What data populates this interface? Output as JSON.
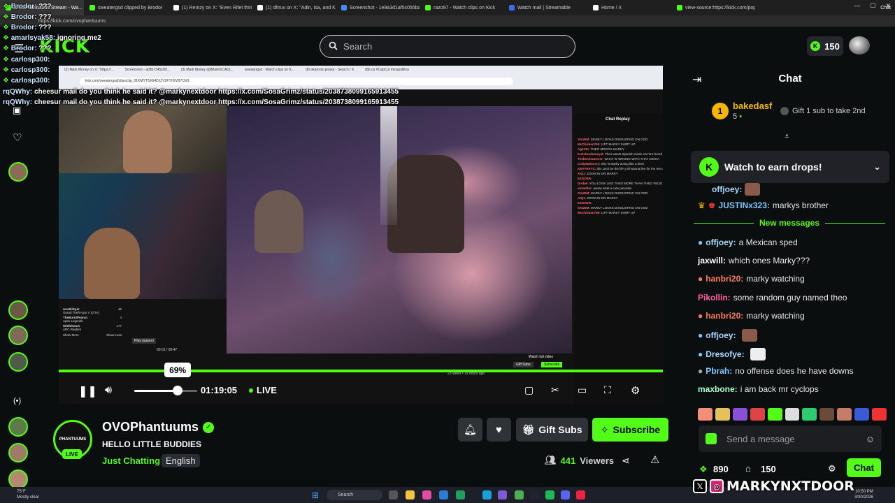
{
  "browser": {
    "tabs": [
      {
        "label": "OVOPhantuums Stream - Wa...",
        "active": true
      },
      {
        "label": "sweatergsd clipped by Brodor"
      },
      {
        "label": "(1) Remzy on X: \"Even Rifet thinks\""
      },
      {
        "label": "(1) dhruv on X: \"Adin, isa, and Kai\""
      },
      {
        "label": "Screenshot - 1e9a3d1af5c055ba7..."
      },
      {
        "label": "razo97 - Watch clips on Kick"
      },
      {
        "label": "Watch mail | Streamable"
      },
      {
        "label": "Home / X"
      },
      {
        "label": "view-source:https://kick.com/pop..."
      }
    ],
    "url": "https://kick.com/ovophantuums",
    "chat_button": "Chat"
  },
  "header": {
    "logo": "KICK",
    "search_placeholder": "Search",
    "coins": "150"
  },
  "overlay_chat": [
    {
      "user": "Brodor:",
      "text": "???"
    },
    {
      "user": "Brodor:",
      "text": "???"
    },
    {
      "user": "Brodor:",
      "text": "???"
    },
    {
      "user": "amarlsyak58:",
      "text": "ignoring me2"
    },
    {
      "user": "Brodor:",
      "text": "???"
    },
    {
      "user": "carlosp300:",
      "text": ""
    },
    {
      "user": "carlosp300:",
      "text": ""
    },
    {
      "user": "carlosp300:",
      "text": ""
    },
    {
      "user": "rqQWhy:",
      "text": "cheesur mail do you think he said it? @markynextdoor https://x.com/SosaGrimz/status/2038738099165913455"
    },
    {
      "user": "rqQWhy:",
      "text": "cheesur mail do you think he said it? @markynextdoor https://x.com/SosaGrimz/status/2038738099165913455"
    }
  ],
  "video": {
    "inner_tabs": [
      "(2) Mark Money on X: \"https://...",
      "Screenshot - a08b7345189...",
      "(3) Mark Money (@MarkInCAD)...",
      "sweatergsd - Watch clips on K...",
      "(8) okamoto jersey - Search / X",
      "(8)Los #CapCut #sospollitos"
    ],
    "inner_url": "kick.com/sweatergsd/clips/clip_01KMYT59G4DJZV2FTH2VB7CM1",
    "inner_chat_title": "Chat Replay",
    "inner_chat_lines": [
      {
        "user": "SAUEM:",
        "text": "MARKY LOOKS DISGUSTING ON GOD"
      },
      {
        "user": "McChicken769:",
        "text": "LIFT MARKY SHIRT UP"
      },
      {
        "user": "Ag213x:",
        "text": "THEO MOGGS MARKY"
      },
      {
        "user": "brandondumeyal:",
        "text": "Theo wants Spanish music on he's bored"
      },
      {
        "user": "Thebestnamever:",
        "text": "WHAT IS WRONG WITH THAT NIGGA"
      },
      {
        "user": "CodyMahoney:",
        "text": "why is Marky acting like a bitch"
      },
      {
        "user": "KEVYNVYC:",
        "text": "this can't be the life y'all wanna live for the rest of y'all life"
      },
      {
        "user": "AIQ1:",
        "text": "ZOOM IN ON MARKY"
      },
      {
        "user": "EZGOER:",
        "text": ""
      },
      {
        "user": "Dorbel:",
        "text": "YOU LOOK LIKE THEO MORE THAN THEO VIEJO"
      },
      {
        "user": "vintwilter:",
        "text": "awww what a cute pasoolie"
      },
      {
        "user": "SAUEM:",
        "text": "MARKY LOOKS DISGUSTING ON GOD"
      },
      {
        "user": "AIQ1:",
        "text": "ZOOM IN ON MARKY"
      },
      {
        "user": "EZGOER:",
        "text": ""
      },
      {
        "user": "SAUEM:",
        "text": "MARKY LOOKS DISGUSTING ON GOD"
      },
      {
        "user": "McChicken769:",
        "text": "LIFT MARKY SHIRT UP"
      }
    ],
    "inner_views": "23 views • 19 hours ago",
    "inner_buttons": [
      "Gift Subs",
      "Subscribe",
      "Watch full video"
    ],
    "inner_stream_list": [
      {
        "name": "westkitty4r",
        "game": "Grand Theft Auto V (GTA)",
        "count": "45"
      },
      {
        "name": "TheBurntPeanut",
        "game": "Apex Legends",
        "count": "4"
      },
      {
        "name": "Wittlebears",
        "game": "ARC Raiders",
        "count": "177"
      }
    ],
    "inner_show": [
      "Show More",
      "Show Less"
    ],
    "inner_time": "00:01 / 00:47",
    "inner_tooltip": "Play (space)"
  },
  "player": {
    "volume_percent": 69,
    "volume_tooltip": "69%",
    "time": "01:19:05",
    "live_label": "LIVE"
  },
  "stream": {
    "channel_name": "OVOPhantuums",
    "avatar_text": "PHANTUUMS",
    "live_badge": "LIVE",
    "title": "HELLO LITTLE BUDDIES",
    "category": "Just Chatting",
    "language": "English",
    "gift_subs": "Gift Subs",
    "subscribe": "Subscribe",
    "viewers_count": "441",
    "viewers_label": "Viewers"
  },
  "chat": {
    "title": "Chat",
    "pinned_user": "bakedasf",
    "pinned_rank": "1",
    "pinned_count": "5",
    "gift_prompt": "Gift 1 sub to take 2nd",
    "drops_banner": "Watch to earn drops!",
    "partial_user": "offjoey:",
    "messages_before": [
      {
        "user": "JUSTINx323:",
        "text": "markys brother",
        "color": "#53fc18"
      }
    ],
    "new_messages_label": "New messages",
    "messages": [
      {
        "user": "offjoey:",
        "text": "a Mexican sped",
        "color": "#a8d8ff"
      },
      {
        "user": "jaxwill:",
        "text": "which ones Marky???",
        "color": "#ffffff"
      },
      {
        "user": "hanbri20:",
        "text": "marky watching",
        "color": "#ff7a59"
      },
      {
        "user": "Pikollin:",
        "text": "some random guy named theo",
        "color": "#ff5fa2"
      },
      {
        "user": "hanbri20:",
        "text": "marky watching",
        "color": "#ff7a59"
      },
      {
        "user": "offjoey:",
        "text": "",
        "color": "#a8d8ff"
      },
      {
        "user": "Dresofye:",
        "text": "",
        "color": "#a8d8ff"
      },
      {
        "user": "Pbrah:",
        "text": "no offense does he have downs",
        "color": "#7ec8ff"
      },
      {
        "user": "maxbone:",
        "text": "i am back mr cyclops",
        "color": "#a8ffcf"
      }
    ],
    "send_placeholder": "Send a message",
    "points": "890",
    "subs": "150",
    "chat_button": "Chat"
  },
  "watermark": "MARKYNXTDOOR",
  "taskbar": {
    "weather_temp": "75°F",
    "weather_desc": "Mostly clear",
    "search": "Search",
    "clock_time": "10:50 PM",
    "clock_date": "3/30/2026"
  },
  "colors": {
    "kick_green": "#53fc18",
    "background": "#0b0e0f",
    "panel": "#2f3237"
  }
}
